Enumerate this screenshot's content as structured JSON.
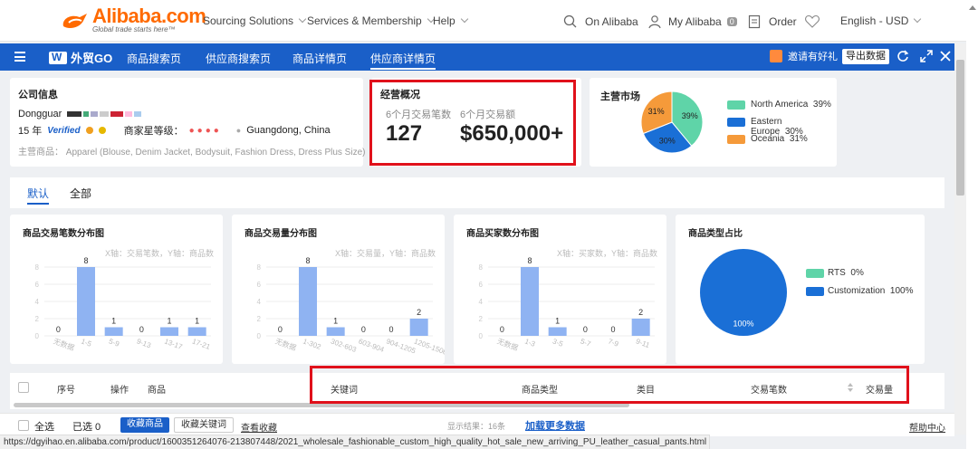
{
  "site": {
    "logo": "Alibaba.com",
    "tagline": "Global trade starts here™",
    "nav": [
      "Sourcing Solutions",
      "Services & Membership",
      "Help"
    ],
    "search_label": "On Alibaba",
    "my_alibaba": "My Alibaba",
    "my_alibaba_count": "0",
    "order": "Order",
    "locale": "English - USD"
  },
  "app": {
    "brand": "外贸GO",
    "tabs": [
      "商品搜索页",
      "供应商搜索页",
      "商品详情页",
      "供应商详情页"
    ],
    "active_tab": 3,
    "invite": "邀请有好礼",
    "export": "导出数据"
  },
  "company": {
    "title": "公司信息",
    "name": "Dongguar",
    "years": "15 年",
    "verified": "Verified",
    "star_label": "商家星等级：",
    "location": "Guangdong, China",
    "main_products_label": "主营商品：",
    "main_products": "Apparel (Blouse, Denim Jacket, Bodysuit, Fashion Dress, Dress Plus Size)"
  },
  "overview": {
    "title": "经营概况",
    "tx_count_label": "6个月交易笔数",
    "tx_count": "127",
    "tx_amount_label": "6个月交易额",
    "tx_amount": "$650,000+"
  },
  "market": {
    "title": "主营市场",
    "legend": [
      {
        "name": "North America",
        "pct": "39%",
        "color": "#5fd4a8"
      },
      {
        "name": "Eastern Europe",
        "pct": "30%",
        "color": "#1a6fd6"
      },
      {
        "name": "Oceania",
        "pct": "31%",
        "color": "#f59a3a"
      }
    ]
  },
  "tabs": {
    "items": [
      "默认",
      "全部"
    ],
    "active": 0
  },
  "charts_text": {
    "c1_title": "商品交易笔数分布图",
    "c1_axis": "X轴：交易笔数，Y轴：商品数",
    "c2_title": "商品交易量分布图",
    "c2_axis": "X轴：交易量，Y轴：商品数",
    "c3_title": "商品买家数分布图",
    "c3_axis": "X轴：买家数，Y轴：商品数",
    "c4_title": "商品类型占比"
  },
  "chart_data": [
    {
      "type": "bar",
      "title": "商品交易笔数分布图",
      "categories": [
        "无数据",
        "1-5",
        "5-9",
        "9-13",
        "13-17",
        "17-21"
      ],
      "values": [
        0,
        8,
        1,
        0,
        1,
        1
      ],
      "ylim": [
        0,
        8
      ],
      "yticks": [
        0,
        2,
        4,
        6,
        8
      ]
    },
    {
      "type": "bar",
      "title": "商品交易量分布图",
      "categories": [
        "无数据",
        "1-302",
        "302-603",
        "603-904",
        "904-1205",
        "1205-1506"
      ],
      "values": [
        0,
        8,
        1,
        0,
        0,
        2
      ],
      "ylim": [
        0,
        8
      ],
      "yticks": [
        0,
        2,
        4,
        6,
        8
      ]
    },
    {
      "type": "bar",
      "title": "商品买家数分布图",
      "categories": [
        "无数据",
        "1-3",
        "3-5",
        "5-7",
        "7-9",
        "9-11"
      ],
      "values": [
        0,
        8,
        1,
        0,
        0,
        2
      ],
      "ylim": [
        0,
        8
      ],
      "yticks": [
        0,
        2,
        4,
        6,
        8
      ]
    },
    {
      "type": "pie",
      "title": "商品类型占比",
      "categories": [
        "RTS",
        "Customization"
      ],
      "values": [
        0,
        100
      ],
      "labels": [
        "0%",
        "100%"
      ],
      "colors": [
        "#5fd4a8",
        "#1a6fd6"
      ]
    },
    {
      "type": "pie",
      "title": "主营市场",
      "categories": [
        "North America",
        "Eastern Europe",
        "Oceania"
      ],
      "values": [
        39,
        30,
        31
      ],
      "colors": [
        "#5fd4a8",
        "#1a6fd6",
        "#f59a3a"
      ]
    }
  ],
  "table": {
    "headers": [
      "序号",
      "操作",
      "商品",
      "关键词",
      "商品类型",
      "类目",
      "交易笔数",
      "交易量"
    ]
  },
  "footer": {
    "select_all": "全选",
    "selected": "已选 0",
    "collect_products": "收藏商品",
    "collect_keywords": "收藏关键词",
    "view_collection": "查看收藏",
    "result_count": "显示结果：16条",
    "load_more": "加载更多数据",
    "help": "帮助中心"
  },
  "status_url": "https://dgyihao.en.alibaba.com/product/1600351264076-213807448/2021_wholesale_fashionable_custom_high_quality_hot_sale_new_arriving_PU_leather_casual_pants.html"
}
